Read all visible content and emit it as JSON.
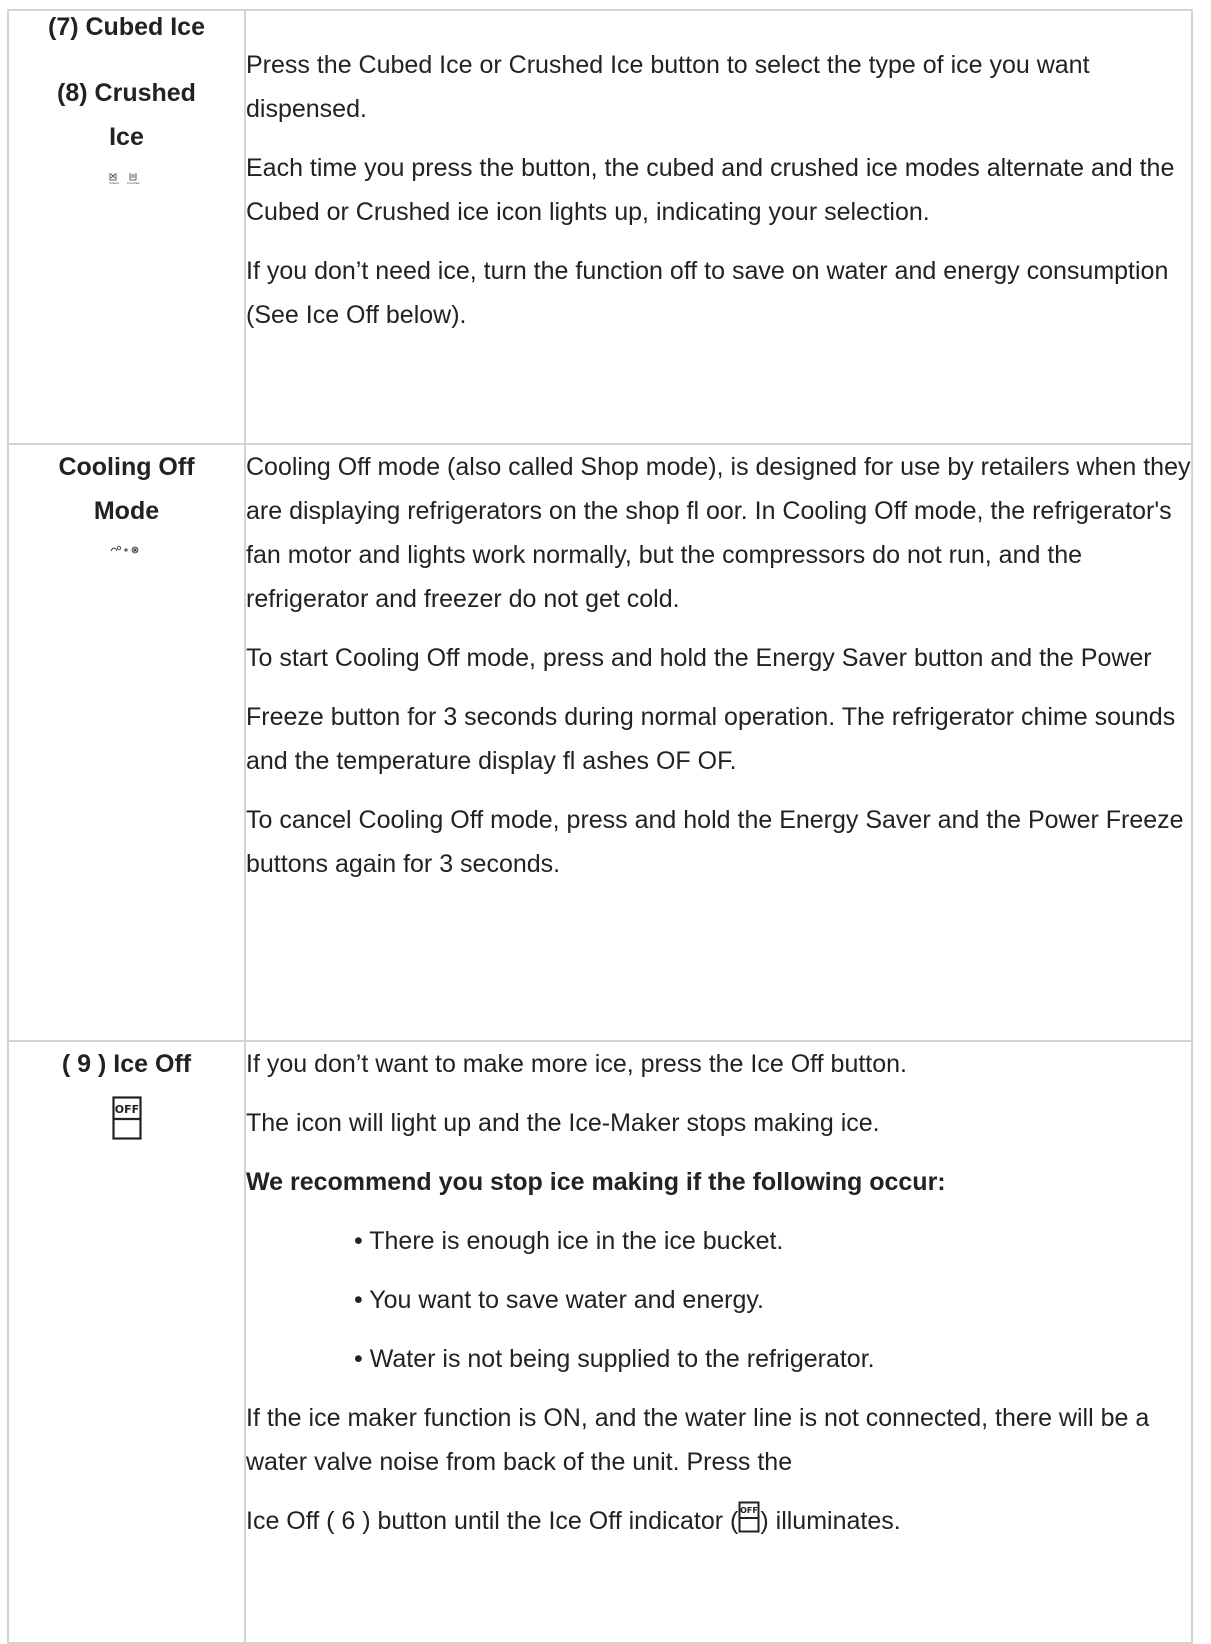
{
  "rows": [
    {
      "labels": [
        "(7) Cubed Ice",
        "(8) Crushed",
        "Ice"
      ],
      "icon": "cubed-crushed-icons",
      "paragraphs": [
        "Press the Cubed Ice or Crushed Ice button to select the type of ice you want dispensed.",
        "Each time you press the button, the cubed and crushed ice modes alternate and the Cubed or Crushed ice icon lights up, indicating your selection.",
        "If you don’t need ice, turn the function off to save on water and energy consumption (See Ice Off below)."
      ]
    },
    {
      "labels": [
        "Cooling Off",
        "Mode"
      ],
      "icon": "energy-saver-plus-power-freeze-icon",
      "paragraphs": [
        "Cooling Off mode (also called Shop mode), is designed for use by retailers when they are displaying refrigerators on the shop fl oor. In Cooling Off mode, the refrigerator's fan motor and lights work normally, but the compressors do not run, and the refrigerator and freezer do not get cold.",
        "To start Cooling Off mode, press and hold the Energy Saver button and the Power",
        "Freeze button for 3 seconds during normal operation. The refrigerator chime sounds and the temperature display fl ashes OF OF.",
        "To cancel Cooling Off mode, press and hold the Energy Saver and the Power Freeze buttons again for 3 seconds."
      ]
    },
    {
      "labels": [
        "( 9 ) Ice Off"
      ],
      "icon": "ice-off-icon",
      "icon_text": "OFF",
      "paragraphs": [
        "If you don’t want to make more ice, press the Ice Off button.",
        "The icon will light up and the Ice-Maker stops making ice."
      ],
      "recommend_heading": "We recommend you stop ice making if the following occur:",
      "bullets": [
        "• There is enough ice in the ice bucket.",
        "• You want to save water and energy.",
        "• Water is not being supplied to the refrigerator."
      ],
      "closing": "If the ice maker function is ON, and the water line is not connected, there will be a water valve noise from back of the unit. Press the",
      "final_before": "Ice Off ( 6 ) button until the Ice Off indicator (",
      "final_after": ") illuminates."
    }
  ]
}
